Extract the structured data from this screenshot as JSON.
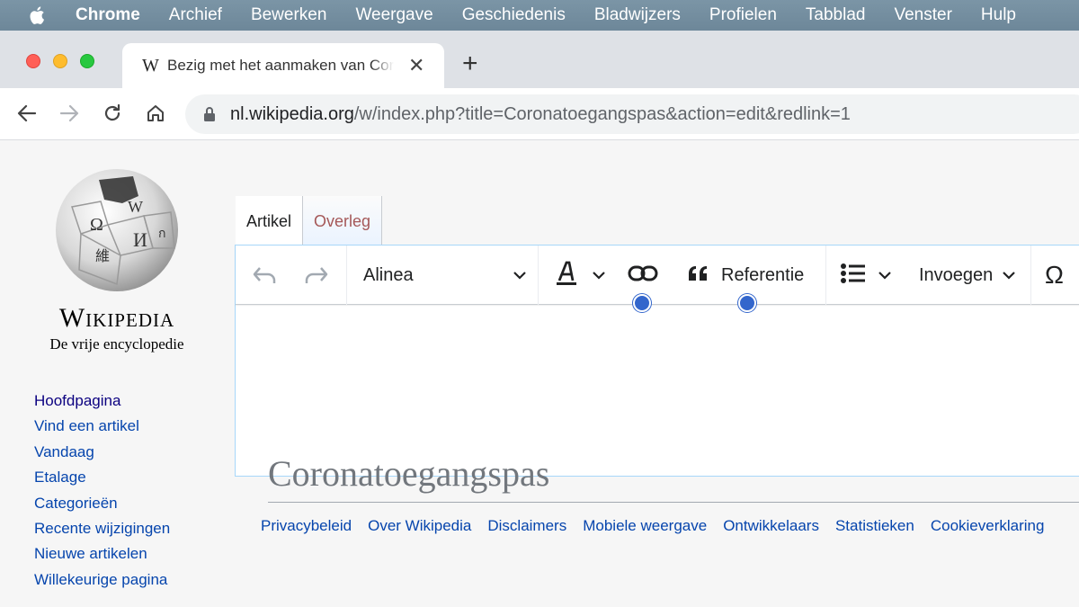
{
  "menubar": {
    "app": "Chrome",
    "items": [
      "Archief",
      "Bewerken",
      "Weergave",
      "Geschiedenis",
      "Bladwijzers",
      "Profielen",
      "Tabblad",
      "Venster",
      "Hulp"
    ]
  },
  "browser": {
    "tab": {
      "favicon": "W",
      "title": "Bezig met het aanmaken van Coronatoegangspas",
      "close_label": "✕"
    },
    "new_tab_label": "+",
    "url_domain": "nl.wikipedia.org",
    "url_path": "/w/index.php?title=Coronatoegangspas&action=edit&redlink=1"
  },
  "wiki": {
    "wordmark": "Wikipedia",
    "tagline": "De vrije encyclopedie",
    "nav": [
      "Hoofdpagina",
      "Vind een artikel",
      "Vandaag",
      "Etalage",
      "Categorieën",
      "Recente wijzigingen",
      "Nieuwe artikelen",
      "Willekeurige pagina"
    ],
    "tabs": {
      "article": "Artikel",
      "talk": "Overleg"
    },
    "editor": {
      "paragraph_format": "Alinea",
      "cite_label": "Referentie",
      "insert_label": "Invoegen",
      "special_char": "Ω",
      "heading": "Coronatoegangspas"
    },
    "footer": [
      "Privacybeleid",
      "Over Wikipedia",
      "Disclaimers",
      "Mobiele weergave",
      "Ontwikkelaars",
      "Statistieken",
      "Cookieverklaring"
    ]
  },
  "colors": {
    "link": "#0645ad",
    "talk_tab": "#a55858",
    "highlight_dot": "#3366cc"
  }
}
